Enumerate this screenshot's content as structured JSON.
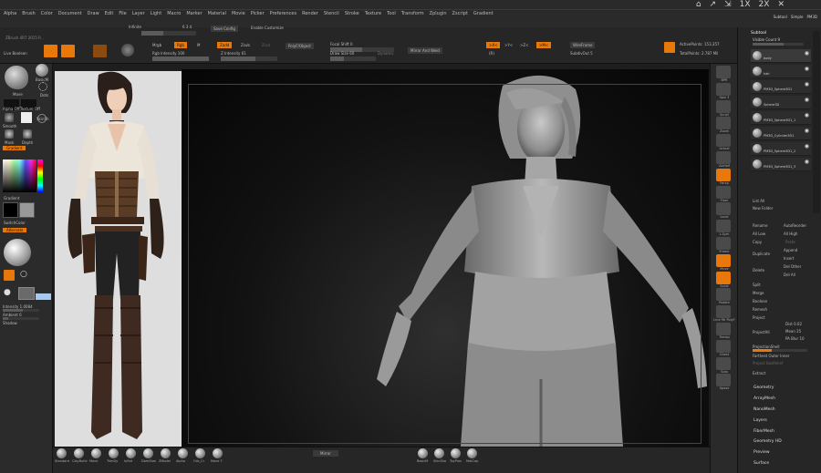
{
  "menubar": {
    "items": [
      "Alpha",
      "Brush",
      "Color",
      "Document",
      "Draw",
      "Edit",
      "File",
      "Layer",
      "Light",
      "Macro",
      "Marker",
      "Material",
      "Movie",
      "Picker",
      "Preferences",
      "Render",
      "Stencil",
      "Stroke",
      "Texture",
      "Tool",
      "Transform",
      "Zplugin",
      "Zscript",
      "Gradient"
    ],
    "right_labels": [
      "1X",
      "2X"
    ],
    "right_tabs": [
      "Subtool",
      "Simple",
      "PM3D"
    ]
  },
  "shelf": {
    "version": "ZBrush 4R7 2015 P...",
    "infinite_label": "Infinite",
    "infinite_value": "6 3 4",
    "save_config": "Save Config",
    "enable_customize": "Enable Customize",
    "mrgb": "Mrgb",
    "rgb": "Rgb",
    "m": "M",
    "zadd": "Zadd",
    "zsub": "Zsub",
    "zcut": "Zcut",
    "rgb_intensity": "Rgb Intensity 100",
    "z_intensity": "Z Intensity 61",
    "polyf": "PolyF/Object",
    "focal_shift": "Focal Shift 0",
    "draw_size": "Draw Size 60",
    "dynamic": "Dynamic",
    "mirror_weld": "Mirror And Weld",
    "active_points": "ActivePoints: 153,357",
    "total_points": "TotalPoints: 2.787 Mil",
    "xyz": "XYZ",
    "r": "(R)",
    "wireframe": "WireFrame",
    "mirror_t": "SubdivOut 5"
  },
  "lefttray": {
    "live_boolean": "Live Boolean",
    "move": "Move",
    "basic_material": "BasicM",
    "dots": "Dots",
    "alpha_off": "Alpha Off",
    "texture_off": "Texture Off",
    "smooth": "Smooth",
    "xml_mat": "SkinSh",
    "gradient_label": "Gradient",
    "ssdeep": "SwitchColor",
    "alternate": "Alternate",
    "intensity": "Intensity 1.0084",
    "ambient": "Ambient 6",
    "shadow": "Shadow",
    "mask_label": "Mask",
    "depth_label": "Depth"
  },
  "righttray": {
    "header": "Subtool",
    "visible_count": "Visible Count 9",
    "subtools": [
      "body",
      "hair",
      "PM3D_Sphere3D1",
      "Sphere3D",
      "PM3D_Sphere3D1_1",
      "PM3D_Cylinder3D1",
      "PM3D_Sphere3D1_2",
      "PM3D_Sphere3D1_3"
    ],
    "list_all": "List All",
    "new_folder": "New Folder",
    "rename": "Rename",
    "auto_reorder": "AutoReorder",
    "all_low": "All Low",
    "all_high": "All High",
    "copy": "Copy",
    "paste": "Paste",
    "duplicate": "Duplicate",
    "append": "Append",
    "insert": "Insert",
    "delete": "Delete",
    "del_other": "Del Other",
    "del_all": "Del All",
    "split": "Split",
    "merge": "Merge",
    "boolean": "Boolean",
    "remesh": "Remesh",
    "project": "Project",
    "dist": "Dist 0.02",
    "mean": "Mean 25",
    "pa_blur": "PA Blur 10",
    "projection_shell": "ProjectionShell",
    "project_bas_relief": "Project BasRelief",
    "extract": "Extract",
    "geometry": "Geometry",
    "arraymesh": "ArrayMesh",
    "nanomesh": "NanoMesh",
    "layers": "Layers",
    "fibermesh": "FiberMesh",
    "geometry_hd": "Geometry HD",
    "preview": "Preview",
    "surface": "Surface"
  },
  "rightcol": {
    "labels": [
      "BPR",
      "Spix 3",
      "Scroll",
      "Zoom",
      "Actual",
      "AAHalf",
      "Persp",
      "Floor",
      "Local",
      "L.Sym",
      "Frame",
      "Move",
      "Scale",
      "Rotate",
      "Line Fill PolyF",
      "Transp",
      "Ghost",
      "Solo",
      "Xpose"
    ]
  },
  "bottom": {
    "brushes": [
      "Standard",
      "ClayBuild",
      "Move",
      "TrimDy",
      "Inflat",
      "DamStan",
      "ZModel",
      "Alpha",
      "Orb_Cr",
      "Move T"
    ],
    "mirror": "Mirror",
    "right_brushes": [
      "BasicM",
      "SkinSha",
      "ToyPlas",
      "MatCap"
    ]
  },
  "canvas": {
    "figure_description": ""
  }
}
